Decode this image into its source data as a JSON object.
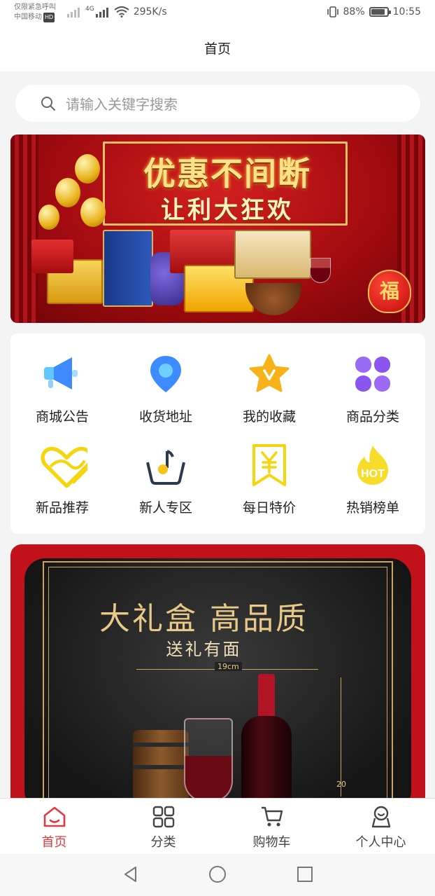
{
  "status_bar": {
    "carrier_line1": "仅限紧急呼叫",
    "carrier_line2": "中国移动",
    "hd_badge": "HD",
    "network_type": "4G",
    "net_speed": "295K/s",
    "battery": "88%",
    "battery_level": 0.88,
    "time": "10:55"
  },
  "header": {
    "title": "首页"
  },
  "search": {
    "placeholder": "请输入关键字搜索"
  },
  "banner": {
    "title": "优惠不间断",
    "subtitle": "让利大狂欢",
    "bag_char": "福"
  },
  "menu": {
    "items": [
      {
        "label": "商城公告",
        "icon": "megaphone-icon"
      },
      {
        "label": "收货地址",
        "icon": "location-pin-icon"
      },
      {
        "label": "我的收藏",
        "icon": "star-icon"
      },
      {
        "label": "商品分类",
        "icon": "category-grid-icon"
      },
      {
        "label": "新品推荐",
        "icon": "new-product-heart-icon"
      },
      {
        "label": "新人专区",
        "icon": "music-basket-icon"
      },
      {
        "label": "每日特价",
        "icon": "yen-ribbon-icon"
      },
      {
        "label": "热销榜单",
        "icon": "hot-flame-icon"
      }
    ]
  },
  "promo": {
    "title": "大礼盒 高品质",
    "subtitle": "送礼有面",
    "dim_label": "19cm",
    "vdim_label": "20"
  },
  "tab_bar": {
    "tabs": [
      {
        "label": "首页",
        "icon": "home-icon",
        "active": true
      },
      {
        "label": "分类",
        "icon": "grid-icon",
        "active": false
      },
      {
        "label": "购物车",
        "icon": "cart-icon",
        "active": false
      },
      {
        "label": "个人中心",
        "icon": "user-icon",
        "active": false
      }
    ]
  },
  "colors": {
    "accent": "#e03a3e",
    "icon_blue": "#3d8bff",
    "icon_yellow": "#f5c518",
    "icon_purple": "#8f5cf0"
  }
}
